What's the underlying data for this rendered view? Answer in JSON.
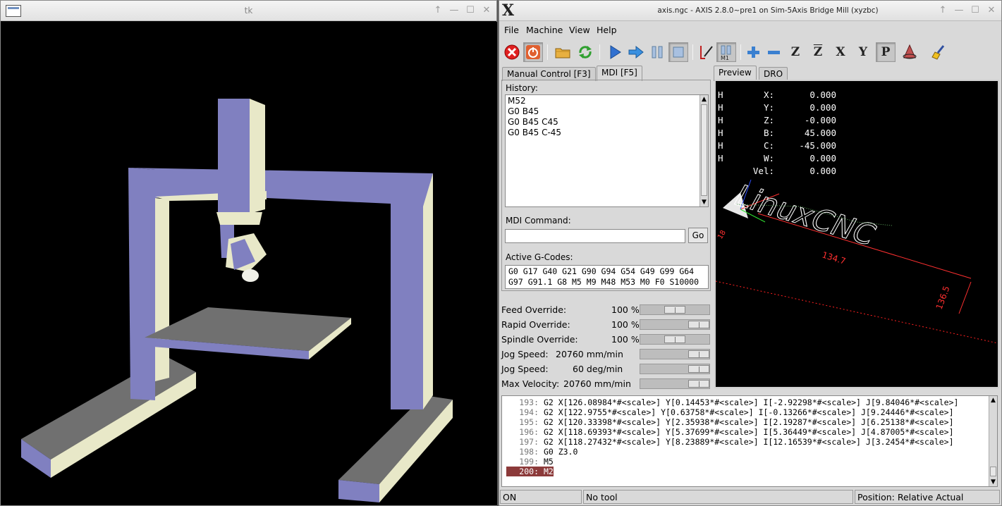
{
  "tk_window": {
    "title": "tk",
    "controls": [
      "up-icon",
      "minimize-icon",
      "maximize-icon",
      "close-icon"
    ]
  },
  "axis_window": {
    "title": "axis.ngc - AXIS 2.8.0~pre1 on Sim-5Axis Bridge Mill (xyzbc)"
  },
  "menubar": {
    "file": "File",
    "machine": "Machine",
    "view": "View",
    "help": "Help"
  },
  "toolbar": {
    "buttons": [
      "estop-icon",
      "machine-power-icon",
      "open-file-icon",
      "reload-icon",
      "run-icon",
      "step-icon",
      "pause-icon",
      "stop-icon",
      "block-delete-icon",
      "optional-stop-icon",
      "zoom-in-icon",
      "zoom-out-icon",
      "view-z-icon",
      "view-z2-icon",
      "view-x-icon",
      "view-y-icon",
      "view-p-icon",
      "rotate-view-icon",
      "clear-plot-icon"
    ]
  },
  "tabs_left": {
    "manual": "Manual Control [F3]",
    "mdi": "MDI [F5]"
  },
  "tabs_right": {
    "preview": "Preview",
    "dro": "DRO"
  },
  "mdi": {
    "history_label": "History:",
    "history": [
      "M52",
      "G0 B45",
      "G0 B45 C45",
      "G0 B45 C-45"
    ],
    "command_label": "MDI Command:",
    "command_value": "",
    "go_label": "Go",
    "active_label": "Active G-Codes:",
    "active_line1": "G0 G17 G40 G21 G90 G94 G54 G49 G99 G64",
    "active_line2": "G97 G91.1 G8 M5 M9 M48 M53 M0 F0 S10000"
  },
  "overrides": {
    "feed": {
      "label": "Feed Override:",
      "value": "100 %",
      "level": 0.5
    },
    "rapid": {
      "label": "Rapid Override:",
      "value": "100 %",
      "level": 1.0
    },
    "spindle": {
      "label": "Spindle Override:",
      "value": "100 %",
      "level": 0.5
    },
    "jog_linear": {
      "label": "Jog Speed:",
      "value": "20760 mm/min",
      "level": 1.0
    },
    "jog_angular": {
      "label": "Jog Speed:",
      "value": "60 deg/min",
      "level": 1.0
    },
    "max_velocity": {
      "label": "Max Velocity:",
      "value": "20760 mm/min",
      "level": 1.0
    }
  },
  "dro": {
    "rows": [
      {
        "home": "H",
        "axis": "X:",
        "value": "0.000"
      },
      {
        "home": "H",
        "axis": "Y:",
        "value": "0.000"
      },
      {
        "home": "H",
        "axis": "Z:",
        "value": "-0.000"
      },
      {
        "home": "H",
        "axis": "B:",
        "value": "45.000"
      },
      {
        "home": "H",
        "axis": "C:",
        "value": "-45.000"
      },
      {
        "home": "H",
        "axis": "W:",
        "value": "0.000"
      },
      {
        "home": "",
        "axis": "Vel:",
        "value": "0.000"
      }
    ]
  },
  "preview": {
    "logo_text": "LinuxCNC",
    "dim_x": "134.7",
    "dim_y": "136.5",
    "dim_z": "18"
  },
  "program": {
    "lines": [
      {
        "num": "193:",
        "text": "G2 X[126.08984*#<scale>] Y[0.14453*#<scale>] I[-2.92298*#<scale>] J[9.84046*#<scale>]"
      },
      {
        "num": "194:",
        "text": "G2 X[122.9755*#<scale>] Y[0.63758*#<scale>] I[-0.13266*#<scale>] J[9.24446*#<scale>]"
      },
      {
        "num": "195:",
        "text": "G2 X[120.33398*#<scale>] Y[2.35938*#<scale>] I[2.19287*#<scale>] J[6.25138*#<scale>]"
      },
      {
        "num": "196:",
        "text": "G2 X[118.69393*#<scale>] Y[5.37699*#<scale>] I[5.36449*#<scale>] J[4.87005*#<scale>]"
      },
      {
        "num": "197:",
        "text": "G2 X[118.27432*#<scale>] Y[8.23889*#<scale>] I[12.16539*#<scale>] J[3.2454*#<scale>]"
      },
      {
        "num": "198:",
        "text": "G0 Z3.0"
      },
      {
        "num": "199:",
        "text": "M5"
      },
      {
        "num": "200:",
        "text": "M2"
      }
    ],
    "current_index": 7
  },
  "status": {
    "machine_state": "ON",
    "tool": "No tool",
    "position": "Position: Relative Actual"
  },
  "colors": {
    "gantry": "#8080c0",
    "gantry_side": "#e8e8c8",
    "table": "#707070",
    "current_line": "#8c3a3a",
    "toolpath": "#ffffff",
    "limits": "#ff2020"
  }
}
